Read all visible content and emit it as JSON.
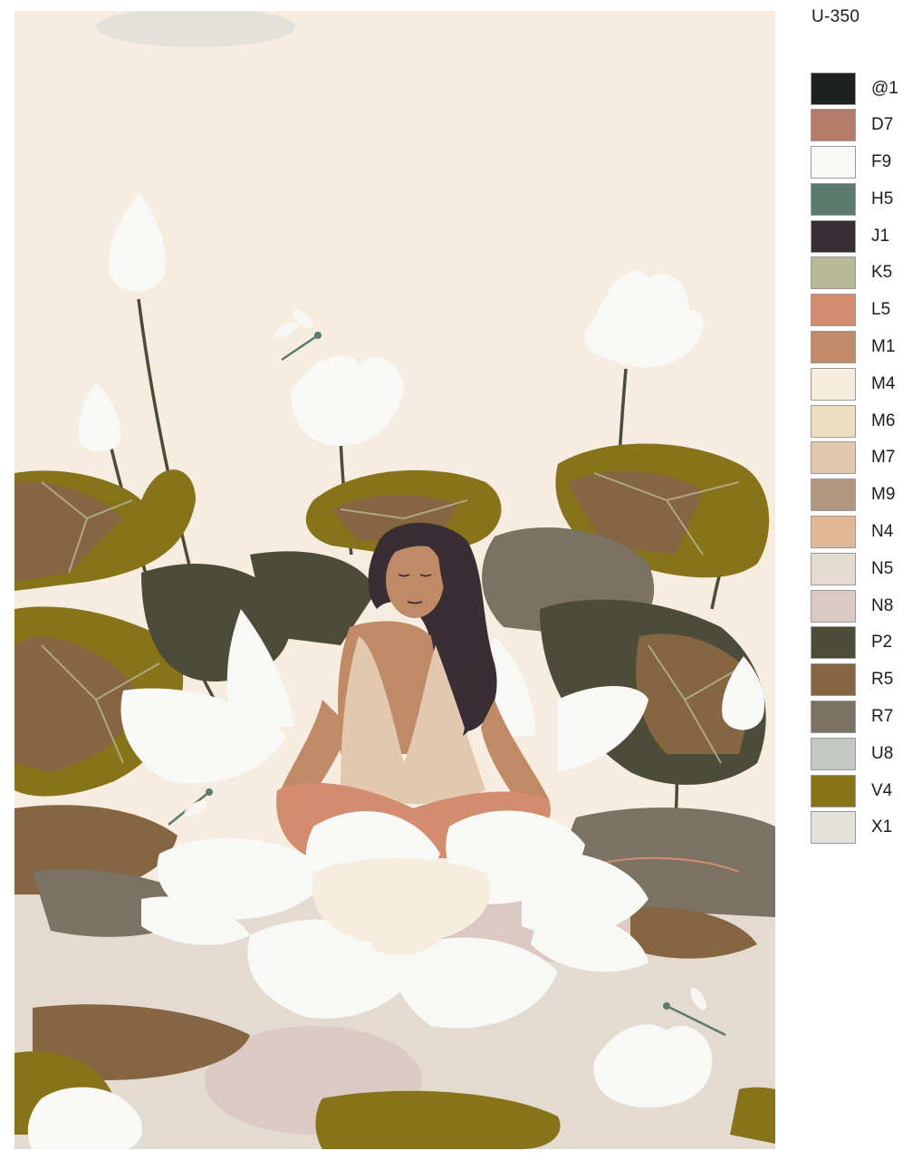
{
  "product_code": "U-350",
  "palette": [
    {
      "code": "@1",
      "color": "#1e2120"
    },
    {
      "code": "D7",
      "color": "#b47b6a"
    },
    {
      "code": "F9",
      "color": "#f8f8f6"
    },
    {
      "code": "H5",
      "color": "#5a7b6d"
    },
    {
      "code": "J1",
      "color": "#382e33"
    },
    {
      "code": "K5",
      "color": "#b6b898"
    },
    {
      "code": "L5",
      "color": "#d38c6e"
    },
    {
      "code": "M1",
      "color": "#c08a66"
    },
    {
      "code": "M4",
      "color": "#f7eddf"
    },
    {
      "code": "M6",
      "color": "#efdcc2"
    },
    {
      "code": "M7",
      "color": "#e1c8ae"
    },
    {
      "code": "M9",
      "color": "#b19780"
    },
    {
      "code": "N4",
      "color": "#e1b795"
    },
    {
      "code": "N5",
      "color": "#e4dbd0"
    },
    {
      "code": "N8",
      "color": "#dcc9c3"
    },
    {
      "code": "P2",
      "color": "#4d4c38"
    },
    {
      "code": "R5",
      "color": "#866642"
    },
    {
      "code": "R7",
      "color": "#7c7264"
    },
    {
      "code": "U8",
      "color": "#c3c8c2"
    },
    {
      "code": "V4",
      "color": "#86731a"
    },
    {
      "code": "X1",
      "color": "#e3e1dc"
    }
  ]
}
